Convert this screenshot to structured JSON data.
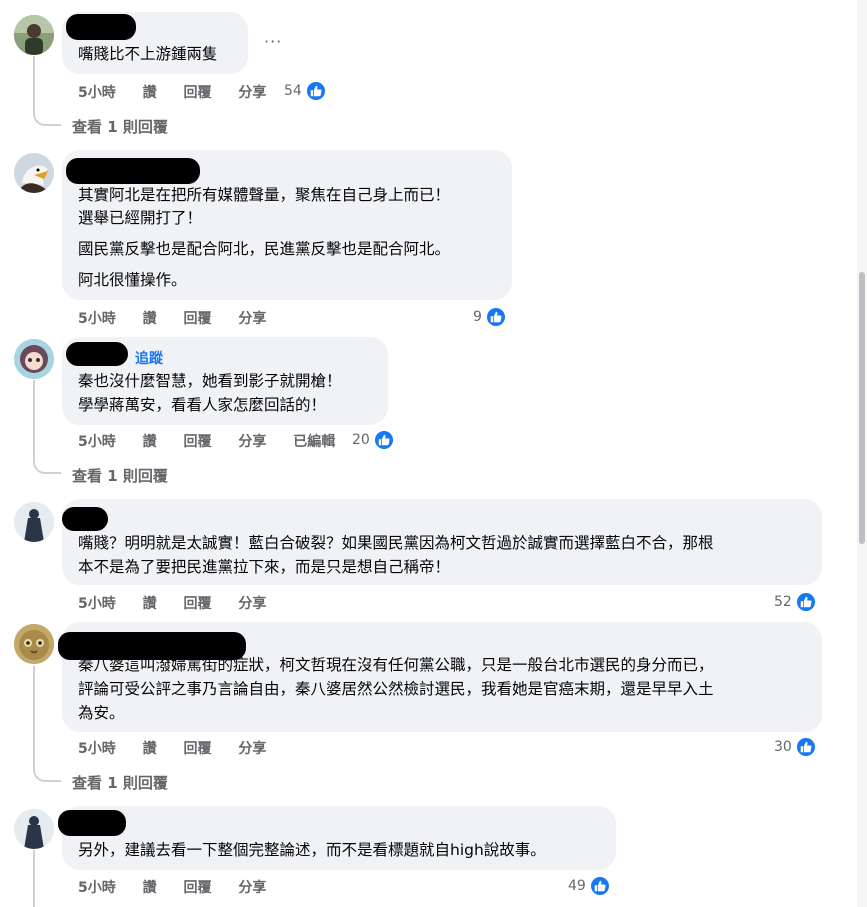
{
  "actions": {
    "like": "讚",
    "reply": "回覆",
    "share": "分享",
    "edited": "已編輯"
  },
  "comments": [
    {
      "time": "5小時",
      "lines": [
        "嘴賤比不上游鍾兩隻"
      ],
      "likes": "54",
      "view_replies": "查看 1 則回覆"
    },
    {
      "time": "5小時",
      "lines": [
        "其實阿北是在把所有媒體聲量，聚焦在自己身上而已！",
        "選舉已經開打了！",
        "國民黨反擊也是配合阿北，民進黨反擊也是配合阿北。",
        "阿北很懂操作。"
      ],
      "likes": "9"
    },
    {
      "time": "5小時",
      "follow": "追蹤",
      "lines": [
        "秦也沒什麼智慧，她看到影子就開槍！",
        "學學蔣萬安，看看人家怎麼回話的！"
      ],
      "likes": "20",
      "view_replies": "查看 1 則回覆"
    },
    {
      "time": "5小時",
      "lines": [
        "嘴賤？明明就是太誠實！藍白合破裂？如果國民黨因為柯文哲過於誠實而選擇藍白不合，那根",
        "本不是為了要把民進黨拉下來，而是只是想自己稱帝！"
      ],
      "likes": "52"
    },
    {
      "time": "5小時",
      "lines": [
        "秦八婆這叫潑婦罵街的症狀，柯文哲現在沒有任何黨公職，只是一般台北市選民的身分而已，",
        "評論可受公評之事乃言論自由，秦八婆居然公然檢討選民，我看她是官癌末期，還是早早入土",
        "為安。"
      ],
      "likes": "30",
      "view_replies": "查看 1 則回覆"
    },
    {
      "time": "5小時",
      "lines": [
        "另外，建議去看一下整個完整論述，而不是看標題就自high說故事。"
      ],
      "likes": "49"
    }
  ],
  "colors": {
    "bubble": "#f0f2f5",
    "like_blue": "#1877f2",
    "secondary_text": "#65676b"
  }
}
